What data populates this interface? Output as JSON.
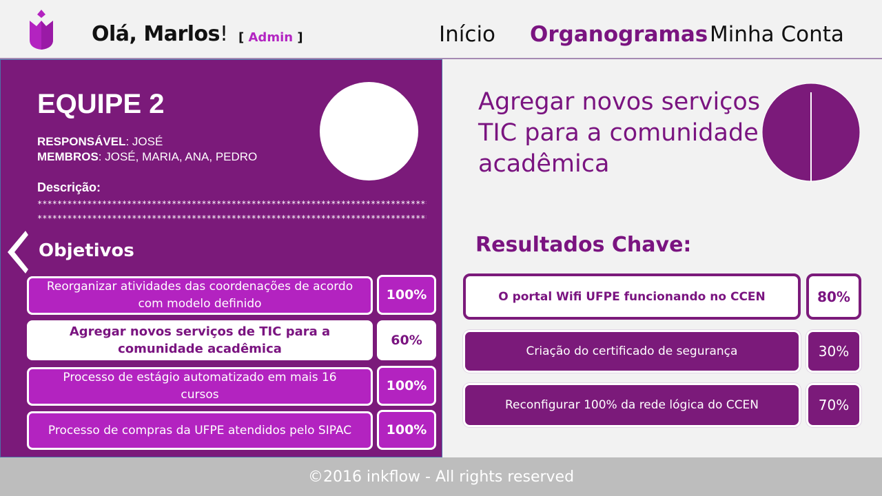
{
  "colors": {
    "brand": "#7b1a7a",
    "accent": "#b323c0",
    "text_dark": "#111111"
  },
  "header": {
    "greeting": "Olá, Marlos",
    "greeting_mark": "!",
    "role_open": "[ ",
    "role": "Admin",
    "role_close": " ]",
    "nav": [
      {
        "label": "Início",
        "active": false
      },
      {
        "label": "Organogramas",
        "active": true
      },
      {
        "label": "Minha Conta",
        "active": false
      }
    ]
  },
  "team": {
    "name": "EQUIPE 2",
    "responsible_label": "RESPONSÁVEL",
    "responsible": ": JOSÉ",
    "members_label": "MEMBROS",
    "members": ": JOSÉ, MARIA, ANA, PEDRO",
    "description_label": "Descrição:",
    "description_lines": [
      "*********************************************************************************",
      "*********************************************************************************"
    ]
  },
  "objectives": {
    "title": "Objetivos",
    "items": [
      {
        "label": "Reorganizar atividades das coordenações de acordo com modelo definido",
        "percent": "100%",
        "selected": false
      },
      {
        "label": "Agregar novos serviços de TIC para a comunidade acadêmica",
        "percent": "60%",
        "selected": true
      },
      {
        "label": "Processo de estágio automatizado em mais 16 cursos",
        "percent": "100%",
        "selected": false
      },
      {
        "label": "Processo de compras da UFPE atendidos pelo SIPAC",
        "percent": "100%",
        "selected": false
      }
    ]
  },
  "goal": {
    "title": "Agregar novos serviços TIC para a comunidade acadêmica",
    "icon": "pie-chart-icon",
    "progress_fraction": 0.5
  },
  "key_results": {
    "title": "Resultados Chave:",
    "items": [
      {
        "label": "O portal Wifi UFPE funcionando no CCEN",
        "percent": "80%",
        "selected": true
      },
      {
        "label": "Criação do certificado de segurança",
        "percent": "30%",
        "selected": false
      },
      {
        "label": "Reconfigurar 100% da rede lógica do CCEN",
        "percent": "70%",
        "selected": false
      }
    ]
  },
  "footer": {
    "text": "©2016  inkflow - All rights reserved"
  }
}
